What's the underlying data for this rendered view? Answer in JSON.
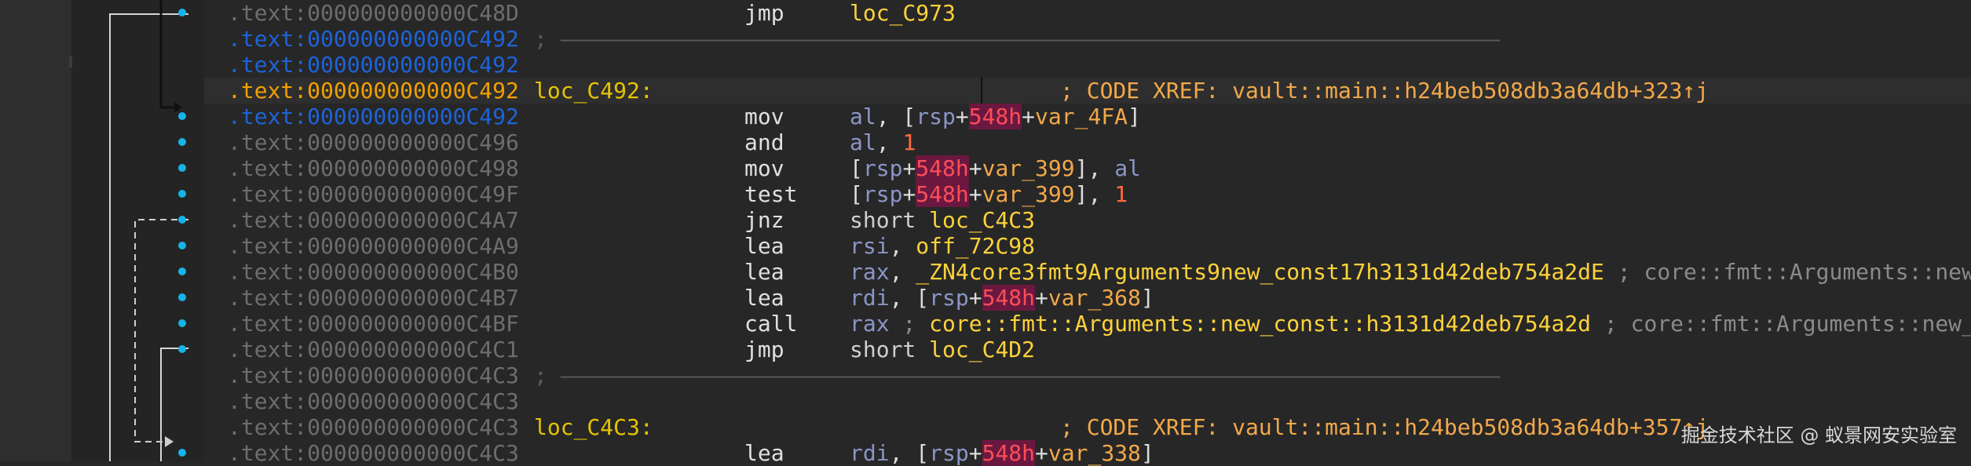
{
  "colors": {
    "background": "#272727",
    "address_gray": "#6d6d6d",
    "address_blue": "#1e63d8",
    "address_current": "#f0a000",
    "label_yellow": "#e6c300",
    "register": "#8a96c8",
    "immediate": "#ff6a3d",
    "highlight_bg": "#6a1840",
    "xref_orange": "#f2a84a",
    "flow_arrow": "#f2e600",
    "breakpoint_dot": "#16b5e8"
  },
  "listing": [
    {
      "addr": ".text:000000000000C48D",
      "addr_style": "gray",
      "mnem": "jmp",
      "ops": [
        {
          "t": "loc_C973",
          "c": "loc"
        }
      ]
    },
    {
      "addr": ".text:000000000000C492",
      "addr_style": "blue",
      "sep": "; ———————————————————————————————————————————————————————————————————————"
    },
    {
      "addr": ".text:000000000000C492",
      "addr_style": "blue"
    },
    {
      "addr": ".text:000000000000C492",
      "addr_style": "orange",
      "current": true,
      "label": "loc_C492:",
      "xref": "; CODE XREF: vault::main::h24beb508db3a64db+323↑j"
    },
    {
      "addr": ".text:000000000000C492",
      "addr_style": "blue",
      "mnem": "mov",
      "ops": [
        {
          "t": "al",
          "c": "reg"
        },
        {
          "t": ", ["
        },
        {
          "t": "rsp",
          "c": "reg"
        },
        {
          "t": "+"
        },
        {
          "t": "548h",
          "c": "hl"
        },
        {
          "t": "+"
        },
        {
          "t": "var_4FA",
          "c": "var"
        },
        {
          "t": "]"
        }
      ]
    },
    {
      "addr": ".text:000000000000C496",
      "addr_style": "gray",
      "mnem": "and",
      "ops": [
        {
          "t": "al",
          "c": "reg"
        },
        {
          "t": ", "
        },
        {
          "t": "1",
          "c": "num"
        }
      ]
    },
    {
      "addr": ".text:000000000000C498",
      "addr_style": "gray",
      "mnem": "mov",
      "ops": [
        {
          "t": "["
        },
        {
          "t": "rsp",
          "c": "reg"
        },
        {
          "t": "+"
        },
        {
          "t": "548h",
          "c": "hl"
        },
        {
          "t": "+"
        },
        {
          "t": "var_399",
          "c": "var"
        },
        {
          "t": "], "
        },
        {
          "t": "al",
          "c": "reg"
        }
      ]
    },
    {
      "addr": ".text:000000000000C49F",
      "addr_style": "gray",
      "mnem": "test",
      "ops": [
        {
          "t": "["
        },
        {
          "t": "rsp",
          "c": "reg"
        },
        {
          "t": "+"
        },
        {
          "t": "548h",
          "c": "hl"
        },
        {
          "t": "+"
        },
        {
          "t": "var_399",
          "c": "var"
        },
        {
          "t": "], "
        },
        {
          "t": "1",
          "c": "num"
        }
      ]
    },
    {
      "addr": ".text:000000000000C4A7",
      "addr_style": "gray",
      "mnem": "jnz",
      "ops": [
        {
          "t": "short ",
          "c": "kw"
        },
        {
          "t": "loc_C4C3",
          "c": "loc"
        }
      ]
    },
    {
      "addr": ".text:000000000000C4A9",
      "addr_style": "gray",
      "mnem": "lea",
      "ops": [
        {
          "t": "rsi",
          "c": "reg"
        },
        {
          "t": ", "
        },
        {
          "t": "off_72C98",
          "c": "loc"
        }
      ]
    },
    {
      "addr": ".text:000000000000C4B0",
      "addr_style": "gray",
      "mnem": "lea",
      "ops": [
        {
          "t": "rax",
          "c": "reg"
        },
        {
          "t": ", "
        },
        {
          "t": "_ZN4core3fmt9Arguments9new_const17h3131d42deb754a2dE",
          "c": "loc"
        },
        {
          "t": " ; core::fmt::Arguments::new",
          "c": "cmt"
        }
      ]
    },
    {
      "addr": ".text:000000000000C4B7",
      "addr_style": "gray",
      "mnem": "lea",
      "ops": [
        {
          "t": "rdi",
          "c": "reg"
        },
        {
          "t": ", ["
        },
        {
          "t": "rsp",
          "c": "reg"
        },
        {
          "t": "+"
        },
        {
          "t": "548h",
          "c": "hl"
        },
        {
          "t": "+"
        },
        {
          "t": "var_368",
          "c": "var"
        },
        {
          "t": "]"
        }
      ]
    },
    {
      "addr": ".text:000000000000C4BF",
      "addr_style": "gray",
      "mnem": "call",
      "ops": [
        {
          "t": "rax",
          "c": "reg"
        },
        {
          "t": " ; ",
          "c": "cmt"
        },
        {
          "t": "core::fmt::Arguments::new_const::h3131d42deb754a2d",
          "c": "loc"
        },
        {
          "t": " ; core::fmt::Arguments::new_",
          "c": "cmt"
        }
      ]
    },
    {
      "addr": ".text:000000000000C4C1",
      "addr_style": "gray",
      "mnem": "jmp",
      "ops": [
        {
          "t": "short ",
          "c": "kw"
        },
        {
          "t": "loc_C4D2",
          "c": "loc"
        }
      ]
    },
    {
      "addr": ".text:000000000000C4C3",
      "addr_style": "gray",
      "sep": "; ———————————————————————————————————————————————————————————————————————"
    },
    {
      "addr": ".text:000000000000C4C3",
      "addr_style": "gray"
    },
    {
      "addr": ".text:000000000000C4C3",
      "addr_style": "gray",
      "label": "loc_C4C3:",
      "xref": "; CODE XREF: vault::main::h24beb508db3a64db+357↑j"
    },
    {
      "addr": ".text:000000000000C4C3",
      "addr_style": "gray",
      "mnem": "lea",
      "ops": [
        {
          "t": "rdi",
          "c": "reg"
        },
        {
          "t": ", ["
        },
        {
          "t": "rsp",
          "c": "reg"
        },
        {
          "t": "+"
        },
        {
          "t": "548h",
          "c": "hl"
        },
        {
          "t": "+"
        },
        {
          "t": "var_338",
          "c": "var"
        },
        {
          "t": "]"
        }
      ]
    }
  ],
  "watermark": "掘金技术社区 @ 蚁景网安实验室"
}
